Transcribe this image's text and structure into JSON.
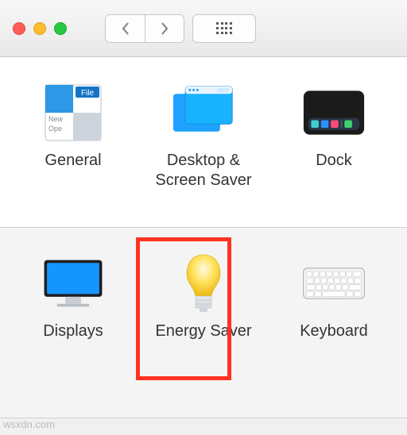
{
  "toolbar": {
    "back_label": "Back",
    "forward_label": "Forward",
    "grid_label": "Show All"
  },
  "row1": {
    "general": {
      "label": "General"
    },
    "desktop": {
      "label": "Desktop & Screen Saver"
    },
    "dock": {
      "label": "Dock"
    }
  },
  "row2": {
    "displays": {
      "label": "Displays"
    },
    "energy": {
      "label": "Energy Saver"
    },
    "keyboard": {
      "label": "Keyboard"
    }
  },
  "watermark": "wsxdn.com",
  "highlighted": "energy"
}
